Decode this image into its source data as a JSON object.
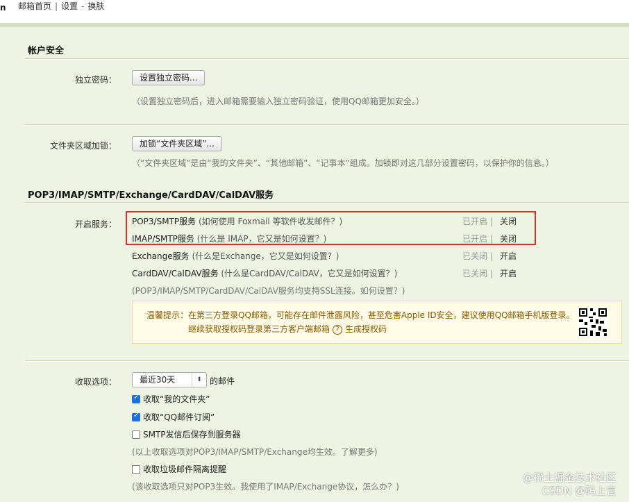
{
  "header": {
    "edge_char": "n",
    "home": "邮箱首页",
    "sep": "|",
    "settings": "设置",
    "dash": "-",
    "skin": "换肤"
  },
  "account_security": {
    "title": "帐户安全",
    "independent_password": {
      "label": "独立密码：",
      "button": "设置独立密码...",
      "hint": "（设置独立密码后，进入邮箱需要输入独立密码验证，使用QQ邮箱更加安全。）"
    },
    "folder_lock": {
      "label": "文件夹区域加锁：",
      "button": "加锁“文件夹区域”...",
      "hint": "（“文件夹区域”是由“我的文件夹”、“其他邮箱”、“记事本”组成。加锁即对这几部分设置密码，以保护你的信息。）"
    }
  },
  "services": {
    "title": "POP3/IMAP/SMTP/Exchange/CardDAV/CalDAV服务",
    "label": "开启服务：",
    "rows": [
      {
        "name": "POP3/SMTP服务",
        "help": "(如何使用 Foxmail 等软件收发邮件？)",
        "state": "已开启 |",
        "action": "关闭"
      },
      {
        "name": "IMAP/SMTP服务",
        "help": "(什么是 IMAP，它又是如何设置？)",
        "state": "已开启 |",
        "action": "关闭"
      },
      {
        "name": "Exchange服务",
        "help": "(什么是Exchange，它又是如何设置？)",
        "state": "已关闭 |",
        "action": "开启"
      },
      {
        "name": "CardDAV/CalDAV服务",
        "help": "(什么是CardDAV/CalDAV，它又是如何设置？)",
        "state": "已关闭 |",
        "action": "开启"
      }
    ],
    "ssl_note": "(POP3/IMAP/SMTP/CardDAV/CalDAV服务均支持SSL连接。如何设置？)",
    "tip": {
      "line1": "温馨提示：在第三方登录QQ邮箱，可能存在邮件泄露风险，甚至危害Apple ID安全，建议使用QQ邮箱手机版登录。",
      "line2a": "继续获取授权码登录第三方客户端邮箱",
      "help_glyph": "?",
      "line2b": "生成授权码"
    }
  },
  "receive": {
    "label": "收取选项：",
    "select_value": "最近30天",
    "select_suffix": "的邮件",
    "options": [
      {
        "text": "收取“我的文件夹”",
        "checked": true
      },
      {
        "text": "收取“QQ邮件订阅”",
        "checked": true
      },
      {
        "text": "SMTP发信后保存到服务器",
        "checked": false
      }
    ],
    "note1": "(以上收取选项对POP3/IMAP/SMTP/Exchange均生效。了解更多)",
    "junk_option": {
      "text": "收取垃圾邮件隔离提醒",
      "checked": false
    },
    "note2": "(该收取选项只对POP3生效。我使用了IMAP/Exchange协议，怎么办？)"
  },
  "watermarks": {
    "line1": "@稀土掘金技术社区",
    "line2": "CSDN @码上言"
  },
  "colors": {
    "panel_bg": "#eef3e2",
    "highlight_border": "#e0302d",
    "checkbox_on": "#1e73d8",
    "tip_bg": "#fffbe6"
  }
}
